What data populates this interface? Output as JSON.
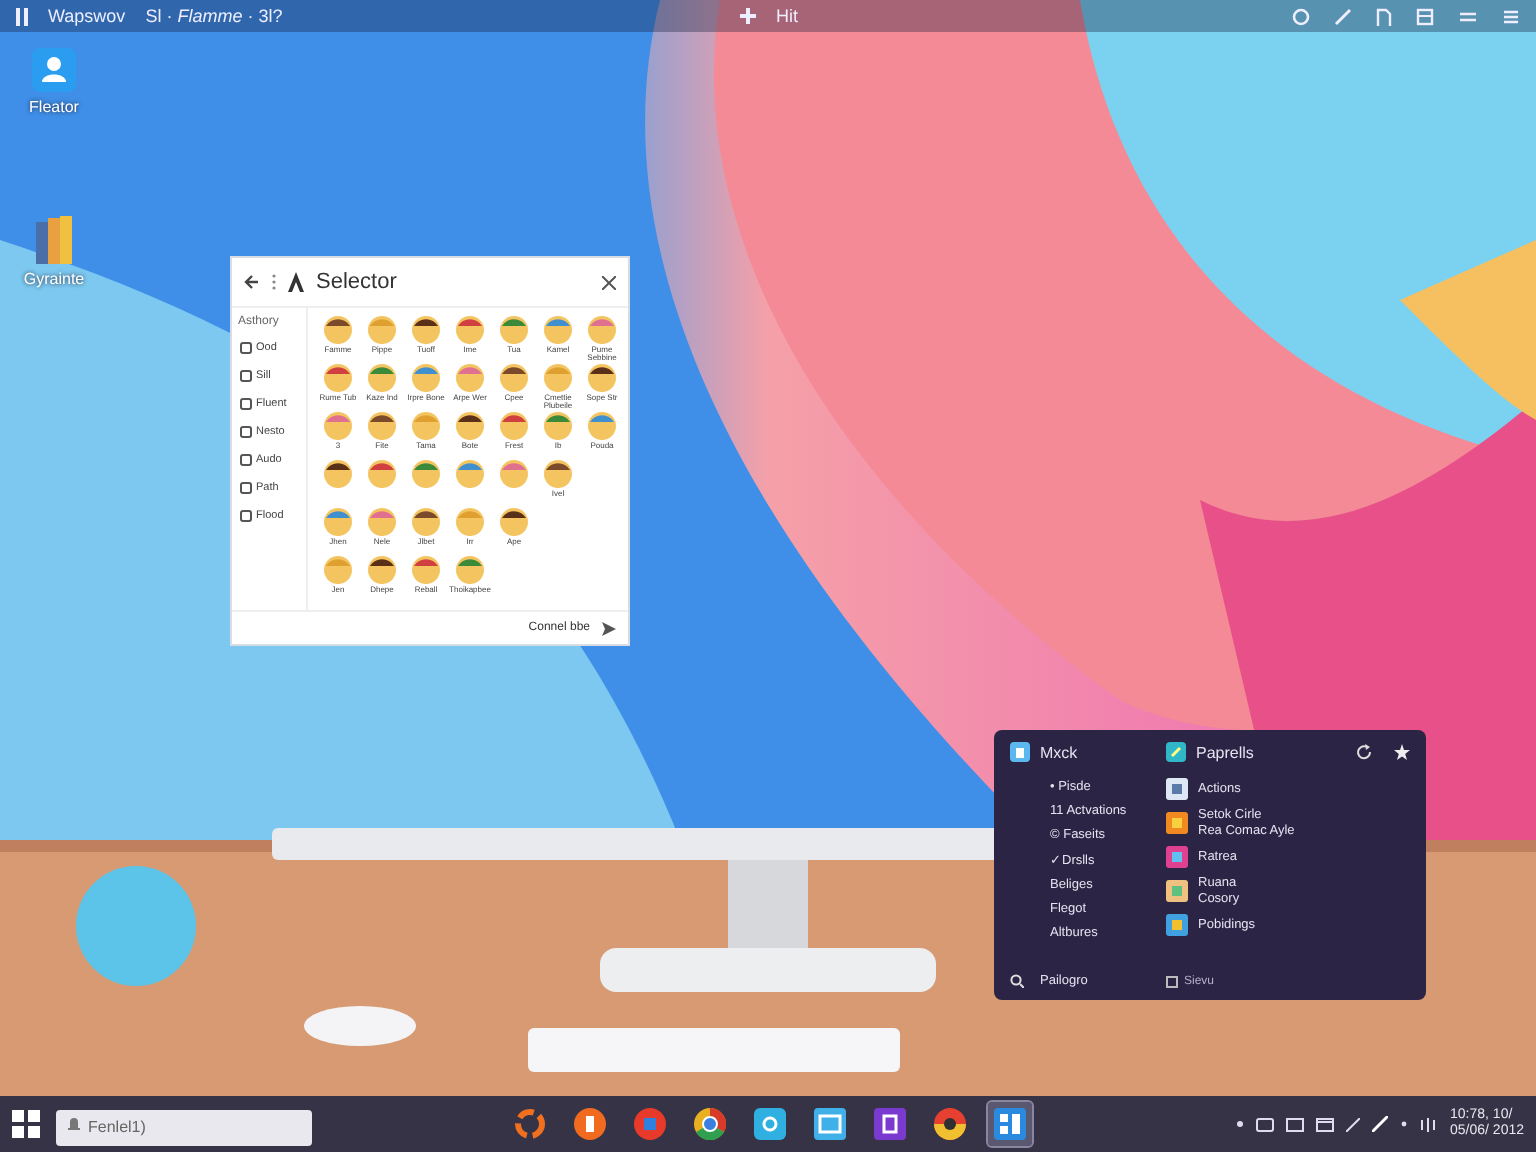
{
  "top_bar": {
    "app_name": "Wapswov",
    "subtitle": "Sl · *Flamme* · 3l?",
    "center_label": "Hit"
  },
  "desktop_icons": [
    {
      "label": "Fleator",
      "kind": "contact"
    },
    {
      "label": "Gyrainte",
      "kind": "books"
    }
  ],
  "selector_window": {
    "title": "Selector",
    "sidebar_heading": "Asthory",
    "sidebar_items": [
      {
        "label": "Ood",
        "selected": false
      },
      {
        "label": "Sill",
        "selected": false
      },
      {
        "label": "Fluent",
        "selected": false
      },
      {
        "label": "Nesto",
        "selected": false
      },
      {
        "label": "Audo",
        "selected": false
      },
      {
        "label": "Path",
        "selected": false
      },
      {
        "label": "Flood",
        "selected": false
      }
    ],
    "emoji_rows": [
      [
        {
          "label": "Famme"
        },
        {
          "label": "Pippe"
        },
        {
          "label": "Tuoff"
        },
        {
          "label": "Ime"
        },
        {
          "label": "Tua"
        },
        {
          "label": "Kamel"
        },
        {
          "label": "Pume Sebbine"
        }
      ],
      [
        {
          "label": "Rume Tub"
        },
        {
          "label": "Kaze Ind"
        },
        {
          "label": "Irpre Bone"
        },
        {
          "label": "Arpe Wer"
        },
        {
          "label": "Cpee"
        },
        {
          "label": "Cmettie Plubeile"
        },
        {
          "label": "Sope Str"
        }
      ],
      [
        {
          "label": "3"
        },
        {
          "label": "Fite"
        },
        {
          "label": "Tama"
        },
        {
          "label": "Bote"
        },
        {
          "label": "Frest"
        },
        {
          "label": "Ib"
        },
        {
          "label": "Pouda"
        }
      ],
      [
        {},
        {},
        {},
        {},
        {},
        {
          "label": "Ivel"
        }
      ],
      [
        {
          "label": "Jhen"
        },
        {
          "label": "Nele"
        },
        {
          "label": "Jlbet"
        },
        {
          "label": "Irr"
        },
        {
          "label": "Ape"
        }
      ],
      [
        {
          "label": "Jen"
        },
        {
          "label": "Dhepe"
        },
        {
          "label": "Reball"
        },
        {
          "label": "Thoikapbee"
        }
      ]
    ],
    "footer_link": "Connel bbe"
  },
  "launcher": {
    "left_title": "Mxck",
    "left_items": [
      "• Pisde",
      "11 Actvations",
      "© Faseits",
      "✓Drslls",
      "Beliges",
      "Flegot",
      "Altbures"
    ],
    "search_label": "Pailogro",
    "right_title": "Paprells",
    "right_items": [
      {
        "lines": [
          "Actions"
        ]
      },
      {
        "lines": [
          "Setok Cirle",
          "Rea Comac Ayle"
        ]
      },
      {
        "lines": [
          "Ratrea"
        ]
      },
      {
        "lines": [
          "Ruana",
          "Cosory"
        ]
      },
      {
        "lines": [
          "Pobidings"
        ]
      }
    ],
    "footer": "Sievu"
  },
  "taskbar": {
    "search": {
      "placeholder": "Fenlel1)"
    },
    "apps": [
      {
        "kind": "ring",
        "selected": false
      },
      {
        "kind": "orange",
        "selected": false
      },
      {
        "kind": "red",
        "selected": false
      },
      {
        "kind": "browser",
        "selected": false
      },
      {
        "kind": "cyan",
        "selected": false
      },
      {
        "kind": "window",
        "selected": false
      },
      {
        "kind": "purple",
        "selected": false
      },
      {
        "kind": "ball",
        "selected": false
      },
      {
        "kind": "grid",
        "selected": true
      }
    ],
    "clock_time": "10:78, 10/",
    "clock_date": "05/06/ 2012"
  }
}
